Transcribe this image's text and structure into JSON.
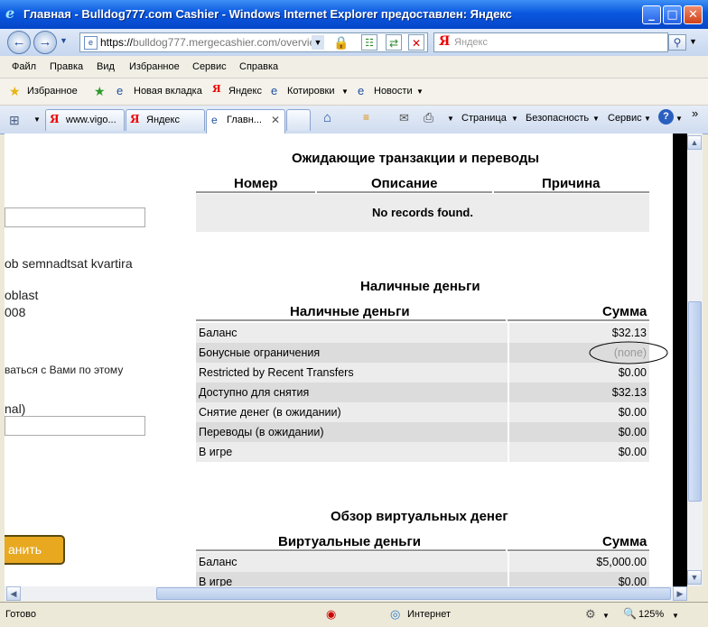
{
  "window": {
    "title": "Главная - Bulldog777.com Cashier - Windows Internet Explorer предоставлен: Яндекс",
    "controls": {
      "minimize": "_",
      "maximize": "□",
      "close": "✕"
    }
  },
  "address": {
    "url_prefix": "https://",
    "url_host": "bulldog777.mergecashier.com",
    "url_path": "/overview",
    "search_placeholder": "Яндекс"
  },
  "menu": [
    "Файл",
    "Правка",
    "Вид",
    "Избранное",
    "Сервис",
    "Справка"
  ],
  "favorites_bar": {
    "favorites": "Избранное",
    "items": [
      "Новая вкладка",
      "Яндекс",
      "Котировки",
      "Новости"
    ]
  },
  "tabs": [
    "www.vigo...",
    "Яндекс",
    "Главн..."
  ],
  "toolbar": {
    "page": "Страница",
    "security": "Безопасность",
    "service": "Сервис"
  },
  "left_fragments": {
    "address_line1": "ob semnadtsat kvartira",
    "address_line2": "oblast",
    "address_line3": "008",
    "contact_text": "ваться с Вами по этому",
    "optional": "nal)",
    "save_button": "анить"
  },
  "pending": {
    "title": "Ожидающие транзакции и переводы",
    "headers": [
      "Номер",
      "Описание",
      "Причина"
    ],
    "empty_text": "No records found."
  },
  "cash": {
    "title": "Наличные деньги",
    "header_name": "Наличные деньги",
    "header_amount": "Сумма",
    "rows": [
      {
        "label": "Баланс",
        "amount": "$32.13"
      },
      {
        "label": "Бонусные ограничения",
        "amount": "(none)"
      },
      {
        "label": "Restricted by Recent Transfers",
        "amount": "$0.00"
      },
      {
        "label": "Доступно для снятия",
        "amount": "$32.13"
      },
      {
        "label": "Снятие денег (в ожидании)",
        "amount": "$0.00"
      },
      {
        "label": "Переводы (в ожидании)",
        "amount": "$0.00"
      },
      {
        "label": "В игре",
        "amount": "$0.00"
      }
    ]
  },
  "virtual": {
    "title": "Обзор виртуальных денег",
    "header_name": "Виртуальные деньги",
    "header_amount": "Сумма",
    "rows": [
      {
        "label": "Баланс",
        "amount": "$5,000.00"
      },
      {
        "label": "В игре",
        "amount": "$0.00"
      }
    ]
  },
  "status": {
    "ready": "Готово",
    "zone": "Интернет",
    "zoom": "125%"
  },
  "colors": {
    "titlebar": "#0a58e0",
    "save_button": "#e8a820",
    "row_light": "#ececec",
    "row_dark": "#dcdcdc"
  }
}
